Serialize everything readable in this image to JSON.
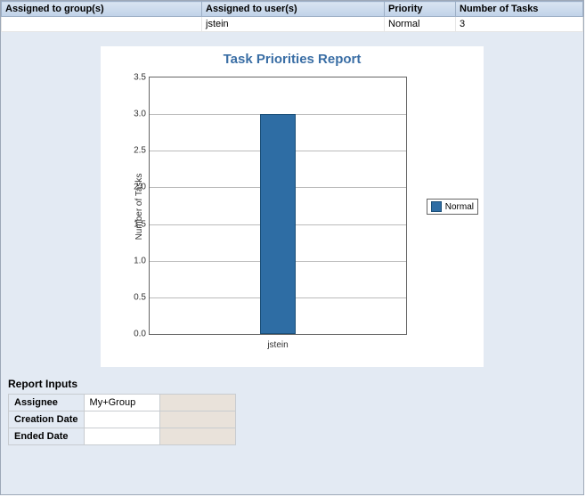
{
  "table": {
    "headers": [
      "Assigned to group(s)",
      "Assigned to user(s)",
      "Priority",
      "Number of Tasks"
    ],
    "row": {
      "group": "",
      "user": "jstein",
      "priority": "Normal",
      "count": "3"
    }
  },
  "chart_data": {
    "type": "bar",
    "title": "Task Priorities Report",
    "ylabel": "Number of Tasks",
    "xlabel": "",
    "ylim": [
      0.0,
      3.5
    ],
    "yticks": [
      0.0,
      0.5,
      1.0,
      1.5,
      2.0,
      2.5,
      3.0,
      3.5
    ],
    "categories": [
      "jstein"
    ],
    "series": [
      {
        "name": "Normal",
        "values": [
          3
        ]
      }
    ],
    "legend_position": "right",
    "grid": true,
    "colors": {
      "Normal": "#2e6da4"
    }
  },
  "inputs": {
    "section_label": "Report Inputs",
    "rows": [
      {
        "key": "Assignee",
        "value": "My+Group"
      },
      {
        "key": "Creation Date",
        "value": ""
      },
      {
        "key": "Ended Date",
        "value": ""
      }
    ]
  }
}
